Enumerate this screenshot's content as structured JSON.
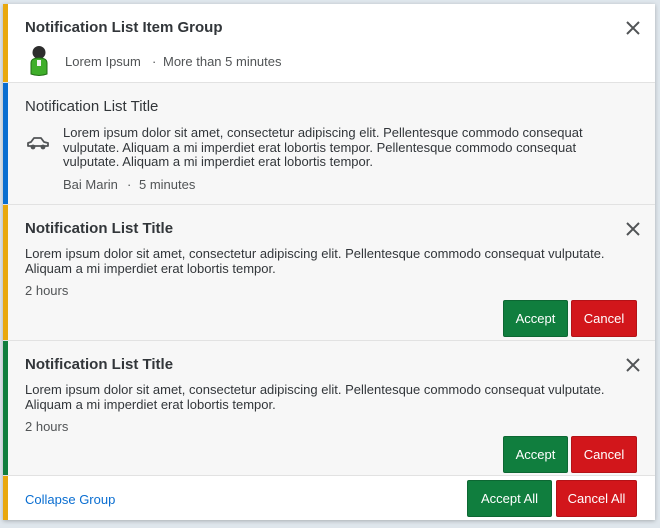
{
  "colors": {
    "warning": "#e9a80d",
    "info": "#0a6ed1",
    "success": "#107e3e",
    "accept": "#107e3e",
    "reject": "#d2161b"
  },
  "group": {
    "title": "Notification List Item Group",
    "author": "Lorem Ipsum",
    "separator": "·",
    "time": "More than 5 minutes",
    "avatar_icon": "user-avatar-icon",
    "close_icon": "close-icon"
  },
  "item1": {
    "title": "Notification List Title",
    "icon": "car-icon",
    "description": "Lorem ipsum dolor sit amet, consectetur adipiscing elit. Pellentesque commodo consequat vulputate. Aliquam a mi imperdiet erat lobortis tempor. Pellentesque commodo consequat vulputate. Aliquam a mi imperdiet erat lobortis tempor.",
    "author": "Bai Marin",
    "separator": "·",
    "time": "5 minutes"
  },
  "item2": {
    "title": "Notification List Title",
    "description": "Lorem ipsum dolor sit amet, consectetur adipiscing elit. Pellentesque commodo consequat vulputate. Aliquam a mi imperdiet erat lobortis tempor.",
    "time": "2 hours",
    "accept_label": "Accept",
    "cancel_label": "Cancel"
  },
  "item3": {
    "title": "Notification List Title",
    "description": "Lorem ipsum dolor sit amet, consectetur adipiscing elit. Pellentesque commodo consequat vulputate. Aliquam a mi imperdiet erat lobortis tempor.",
    "time": "2 hours",
    "accept_label": "Accept",
    "cancel_label": "Cancel"
  },
  "footer": {
    "collapse_label": "Collapse Group",
    "accept_all_label": "Accept All",
    "cancel_all_label": "Cancel All"
  }
}
